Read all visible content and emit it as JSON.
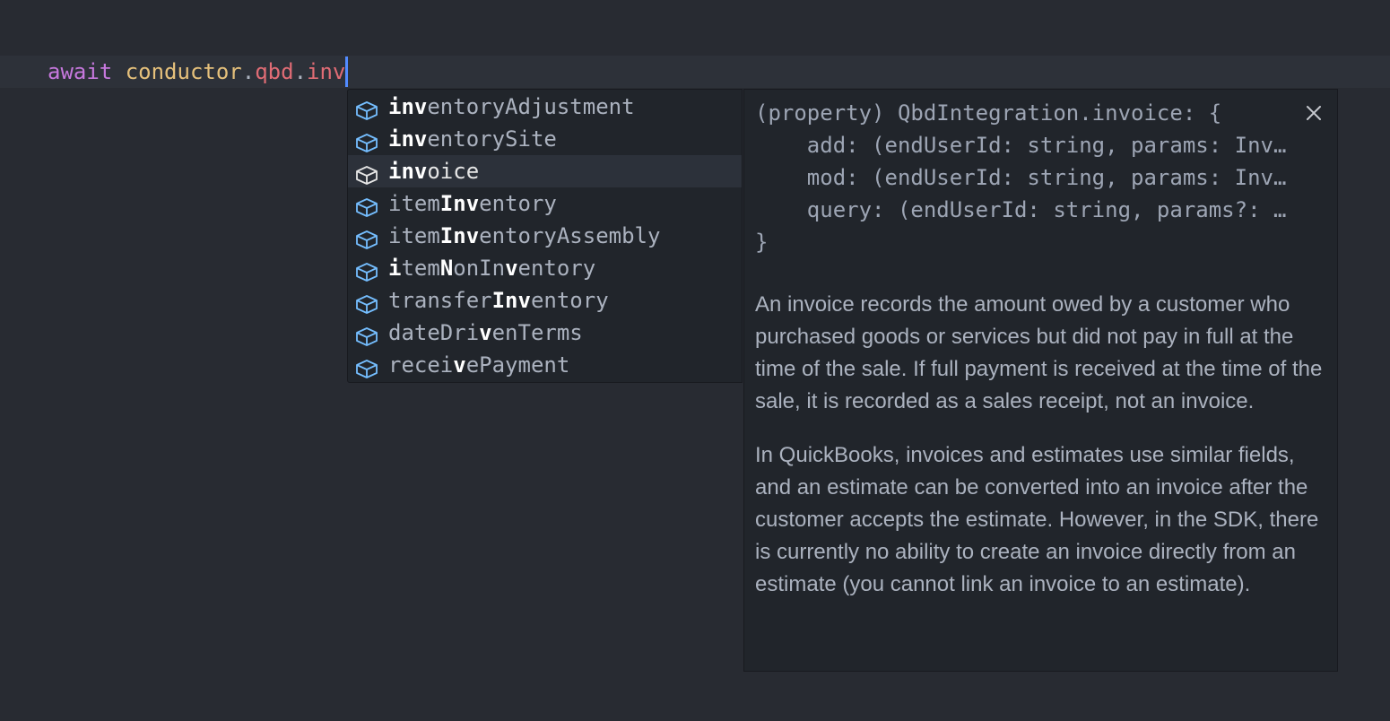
{
  "editor": {
    "code": {
      "keyword": "await",
      "object": "conductor",
      "dot1": ".",
      "prop1": "qbd",
      "dot2": ".",
      "typed": "inv"
    },
    "colors": {
      "background": "#282b32",
      "keyword": "#c678dd",
      "variable": "#e5c07b",
      "property": "#e06c75",
      "cursor": "#528bff",
      "icon": "#75beff"
    }
  },
  "suggestions": [
    {
      "parts": [
        {
          "t": "inv",
          "b": true
        },
        {
          "t": "entoryAdjustment",
          "b": false
        }
      ],
      "icon": "property-cube-icon",
      "focused": false
    },
    {
      "parts": [
        {
          "t": "inv",
          "b": true
        },
        {
          "t": "entorySite",
          "b": false
        }
      ],
      "icon": "property-cube-icon",
      "focused": false
    },
    {
      "parts": [
        {
          "t": "inv",
          "b": true
        },
        {
          "t": "oice",
          "b": false
        }
      ],
      "icon": "property-cube-icon",
      "focused": true
    },
    {
      "parts": [
        {
          "t": "item",
          "b": false
        },
        {
          "t": "Inv",
          "b": true
        },
        {
          "t": "entory",
          "b": false
        }
      ],
      "icon": "property-cube-icon",
      "focused": false
    },
    {
      "parts": [
        {
          "t": "item",
          "b": false
        },
        {
          "t": "Inv",
          "b": true
        },
        {
          "t": "entoryAssembly",
          "b": false
        }
      ],
      "icon": "property-cube-icon",
      "focused": false
    },
    {
      "parts": [
        {
          "t": "i",
          "b": true
        },
        {
          "t": "tem",
          "b": false
        },
        {
          "t": "N",
          "b": true
        },
        {
          "t": "onIn",
          "b": false
        },
        {
          "t": "v",
          "b": true
        },
        {
          "t": "entory",
          "b": false
        }
      ],
      "icon": "property-cube-icon",
      "focused": false
    },
    {
      "parts": [
        {
          "t": "transfer",
          "b": false
        },
        {
          "t": "Inv",
          "b": true
        },
        {
          "t": "entory",
          "b": false
        }
      ],
      "icon": "property-cube-icon",
      "focused": false
    },
    {
      "parts": [
        {
          "t": "dateDri",
          "b": false
        },
        {
          "t": "v",
          "b": true
        },
        {
          "t": "enTerms",
          "b": false
        }
      ],
      "icon": "property-cube-icon",
      "focused": false
    },
    {
      "parts": [
        {
          "t": "recei",
          "b": false
        },
        {
          "t": "v",
          "b": true
        },
        {
          "t": "ePayment",
          "b": false
        }
      ],
      "icon": "property-cube-icon",
      "focused": false
    }
  ],
  "details": {
    "signature": [
      "(property) QbdIntegration.invoice: {",
      "    add: (endUserId: string, params: Inv…",
      "    mod: (endUserId: string, params: Inv…",
      "    query: (endUserId: string, params?: …",
      "}"
    ],
    "close_icon": "close-icon",
    "paragraphs": [
      "An invoice records the amount owed by a customer who purchased goods or services but did not pay in full at the time of the sale. If full payment is received at the time of the sale, it is recorded as a sales receipt, not an invoice.",
      "In QuickBooks, invoices and estimates use similar fields, and an estimate can be converted into an invoice after the customer accepts the estimate. However, in the SDK, there is currently no ability to create an invoice directly from an estimate (you cannot link an invoice to an estimate)."
    ]
  }
}
